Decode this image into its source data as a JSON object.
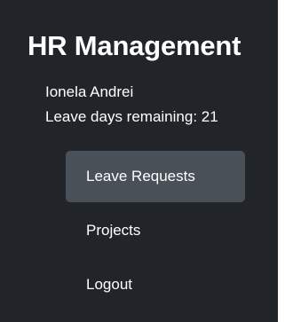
{
  "app": {
    "title": "HR Management"
  },
  "user": {
    "name": "Ionela Andrei",
    "leave_days_text": "Leave days remaining: 21"
  },
  "nav": {
    "items": [
      {
        "label": "Leave Requests",
        "active": true
      },
      {
        "label": "Projects",
        "active": false
      },
      {
        "label": "Logout",
        "active": false
      }
    ]
  },
  "colors": {
    "sidebar_bg": "#212529",
    "active_item_bg": "#495057",
    "text": "#ffffff"
  }
}
